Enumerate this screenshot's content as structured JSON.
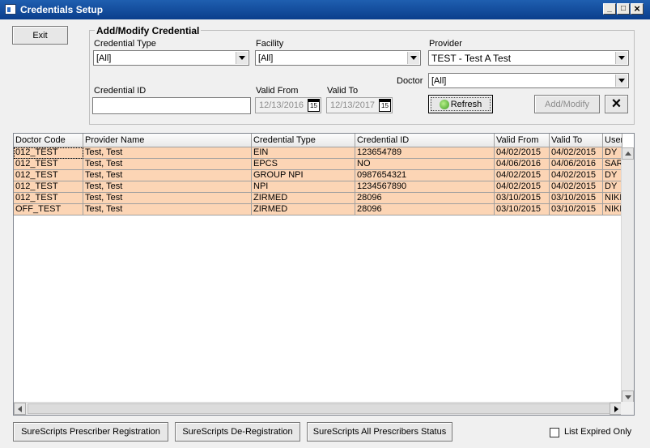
{
  "window": {
    "title": "Credentials Setup",
    "controls": {
      "minimize": "_",
      "maximize": "□",
      "close": "×"
    }
  },
  "exit_button": "Exit",
  "form": {
    "group_title": "Add/Modify Credential",
    "credential_type": {
      "label": "Credential Type",
      "value": "[All]"
    },
    "facility": {
      "label": "Facility",
      "value": "[All]"
    },
    "provider": {
      "label": "Provider",
      "value": "TEST - Test A Test"
    },
    "doctor": {
      "label": "Doctor",
      "value": "[All]"
    },
    "credential_id": {
      "label": "Credential ID",
      "value": ""
    },
    "valid_from": {
      "label": "Valid From",
      "value": "12/13/2016"
    },
    "valid_to": {
      "label": "Valid To",
      "value": "12/13/2017"
    },
    "calendar_icon_text": "15",
    "refresh_button": "Refresh",
    "add_modify_button": "Add/Modify",
    "clear_button": "×"
  },
  "grid": {
    "columns": [
      "Doctor Code",
      "Provider Name",
      "Credential Type",
      "Credential ID",
      "Valid From",
      "Valid To",
      "User"
    ],
    "rows": [
      [
        "012_TEST",
        "Test, Test",
        "EIN",
        "123654789",
        "04/02/2015",
        "04/02/2015",
        "DY"
      ],
      [
        "012_TEST",
        "Test, Test",
        "EPCS",
        "NO",
        "04/06/2016",
        "04/06/2016",
        "SARA"
      ],
      [
        "012_TEST",
        "Test, Test",
        "GROUP NPI",
        "0987654321",
        "04/02/2015",
        "04/02/2015",
        "DY"
      ],
      [
        "012_TEST",
        "Test, Test",
        "NPI",
        "1234567890",
        "04/02/2015",
        "04/02/2015",
        "DY"
      ],
      [
        "012_TEST",
        "Test, Test",
        "ZIRMED",
        "28096",
        "03/10/2015",
        "03/10/2015",
        "NIKH"
      ],
      [
        "OFF_TEST",
        "Test, Test",
        "ZIRMED",
        "28096",
        "03/10/2015",
        "03/10/2015",
        "NIKH"
      ]
    ],
    "row_color": "#fcd5b5"
  },
  "footer": {
    "register_button": "SureScripts Prescriber Registration",
    "deregister_button": "SureScripts De-Registration",
    "status_button": "SureScripts All Prescribers Status",
    "expired_checkbox": {
      "label": "List Expired Only",
      "checked": false
    }
  }
}
